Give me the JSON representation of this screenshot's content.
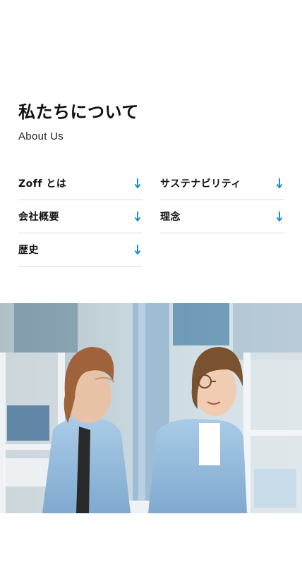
{
  "section": {
    "title": "私たちについて",
    "subtitle": "About Us"
  },
  "nav": {
    "items": [
      {
        "label": "Zoff とは",
        "icon": "arrow-down-icon"
      },
      {
        "label": "サステナビリティ",
        "icon": "arrow-down-icon"
      },
      {
        "label": "会社概要",
        "icon": "arrow-down-icon"
      },
      {
        "label": "理念",
        "icon": "arrow-down-icon"
      },
      {
        "label": "歴史",
        "icon": "arrow-down-icon"
      }
    ]
  },
  "colors": {
    "accent": "#1a8fd1",
    "divider": "#d9d9d9",
    "text": "#111111"
  },
  "photo": {
    "subject": "two-staff-in-light-blue-lab-coats"
  }
}
